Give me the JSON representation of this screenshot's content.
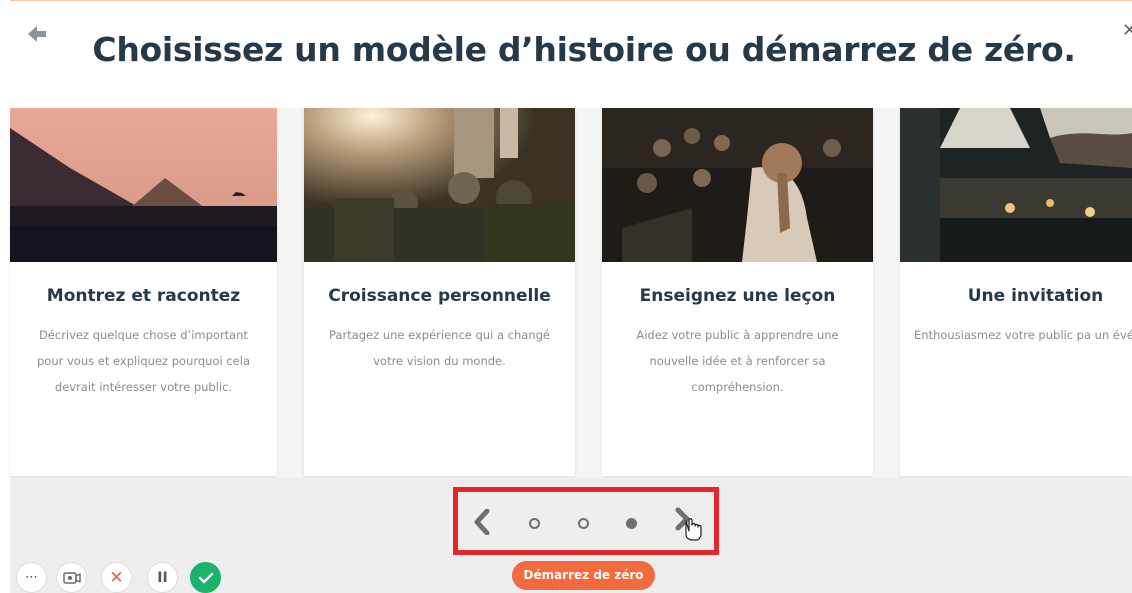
{
  "header": {
    "title": "Choisissez un modèle d’histoire ou démarrez de zéro.",
    "back_icon": "arrow-left-icon",
    "close_icon": "close-icon"
  },
  "cards": [
    {
      "title": "Montrez et racontez",
      "description": "Décrivez quelque chose d’important pour vous et expliquez pourquoi cela devrait intéresser votre public.",
      "image": "pyramids-at-sunset-photo"
    },
    {
      "title": "Croissance personnelle",
      "description": "Partagez une expérience qui a changé votre vision du monde.",
      "image": "festival-crowd-photo"
    },
    {
      "title": "Enseignez une leçon",
      "description": "Aidez votre public à apprendre une nouvelle idée et à renforcer sa compréhension.",
      "image": "speaker-audience-photo"
    },
    {
      "title": "Une invitation",
      "description": "Enthousiasmez votre public pa un événement à venir",
      "image": "dinner-party-photo"
    }
  ],
  "pagination": {
    "prev_icon": "chevron-left-icon",
    "next_icon": "chevron-right-icon",
    "pages": 3,
    "current_page": 3
  },
  "start_button": {
    "label": "Démarrez de zéro"
  },
  "controls": {
    "more": "⋯",
    "camera_icon": "camera-icon",
    "cancel": "✕",
    "pause": "II",
    "done_icon": "check-icon"
  },
  "colors": {
    "title": "#25394a",
    "accent": "#f26a3d",
    "highlight_box": "#e5262c",
    "confirm": "#19b36b"
  }
}
